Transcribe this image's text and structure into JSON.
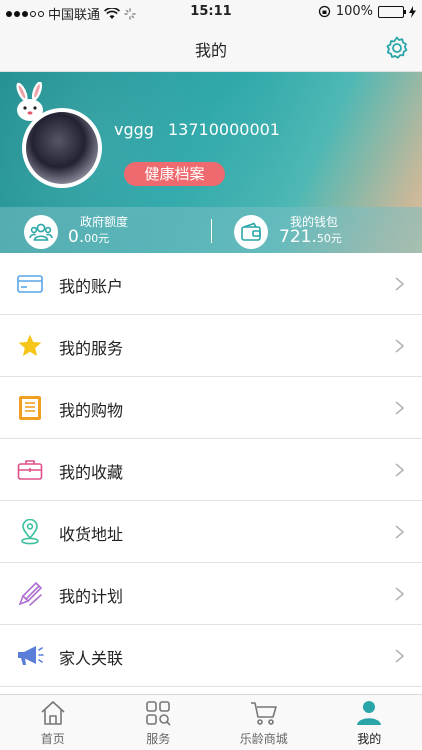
{
  "status_bar": {
    "carrier": "中国联通",
    "time": "15:11",
    "battery": "100%",
    "battery_level": 1.0
  },
  "nav": {
    "title": "我的",
    "settings_icon": "gear-icon"
  },
  "profile": {
    "username": "vggg",
    "phone": "13710000001",
    "health_button": "健康档案"
  },
  "stats": {
    "gov_quota": {
      "label": "政府额度",
      "int": "0.",
      "dec": "00元",
      "icon": "people-icon"
    },
    "wallet": {
      "label": "我的钱包",
      "int": "721.",
      "dec": "50元",
      "icon": "wallet-icon"
    }
  },
  "menu": [
    {
      "label": "我的账户",
      "icon": "card-icon",
      "color": "#5aa6e6"
    },
    {
      "label": "我的服务",
      "icon": "star-icon",
      "color": "#f5c518"
    },
    {
      "label": "我的购物",
      "icon": "list-icon",
      "color": "#f0a020"
    },
    {
      "label": "我的收藏",
      "icon": "briefcase-icon",
      "color": "#e0508a"
    },
    {
      "label": "收货地址",
      "icon": "location-pin-icon",
      "color": "#3cc0a0"
    },
    {
      "label": "我的计划",
      "icon": "pen-icon",
      "color": "#b070d0"
    },
    {
      "label": "家人关联",
      "icon": "megaphone-icon",
      "color": "#5a7ed8"
    }
  ],
  "tabs": [
    {
      "label": "首页",
      "icon": "home-icon"
    },
    {
      "label": "服务",
      "icon": "grid-icon"
    },
    {
      "label": "乐龄商城",
      "icon": "cart-icon"
    },
    {
      "label": "我的",
      "icon": "person-icon",
      "active": true
    }
  ],
  "colors": {
    "accent": "#2aa6a8",
    "health_button": "#ee6a6e"
  }
}
